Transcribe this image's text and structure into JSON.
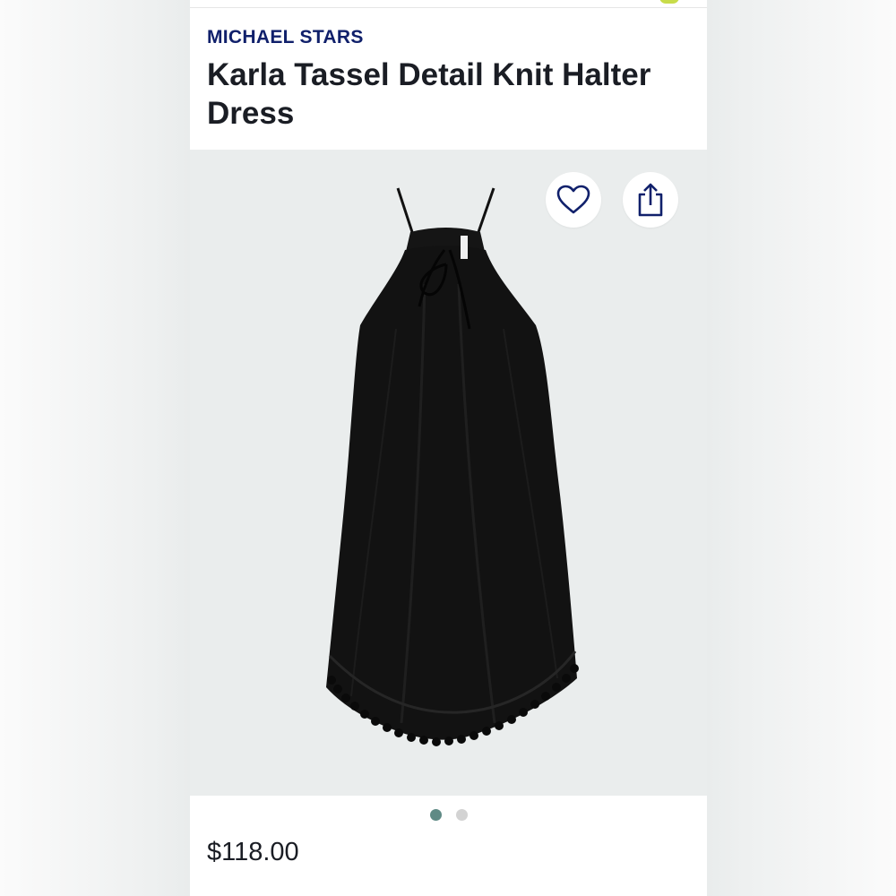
{
  "product": {
    "brand": "MICHAEL STARS",
    "title": "Karla Tassel Detail Knit Halter Dress",
    "price": "$118.00"
  },
  "actions": {
    "favorite_icon": "heart-icon",
    "share_icon": "share-icon"
  },
  "carousel": {
    "image_count": 2,
    "active_index": 0,
    "active_color": "#5f8a85",
    "inactive_color": "#d3d3d3"
  },
  "colors": {
    "brand": "#10206b",
    "title": "#1a1d24",
    "image_background": "#eaeded",
    "icon_color": "#10206b"
  }
}
